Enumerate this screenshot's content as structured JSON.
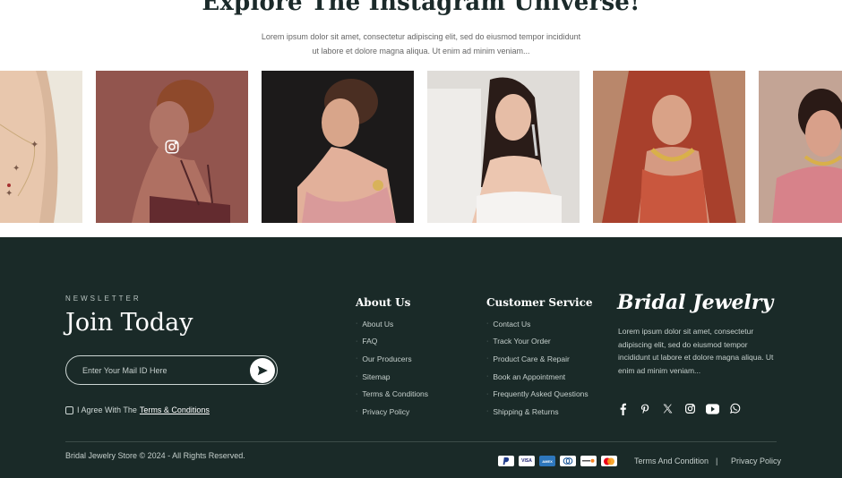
{
  "instagram": {
    "title": "Explore The Instagram Universe!",
    "description": "Lorem ipsum dolor sit amet, consectetur adipiscing elit, sed do eiusmod tempor incididunt ut labore et dolore magna aliqua. Ut enim ad minim veniam..."
  },
  "footer": {
    "newsletter": {
      "kicker": "NEWSLETTER",
      "title": "Join Today",
      "placeholder": "Enter Your Mail ID Here",
      "agree_text": "I Agree With The",
      "agree_link": "Terms & Conditions"
    },
    "about": {
      "title": "About Us",
      "items": [
        "About Us",
        "FAQ",
        "Our Producers",
        "Sitemap",
        "Terms & Conditions",
        "Privacy Policy"
      ]
    },
    "service": {
      "title": "Customer Service",
      "items": [
        "Contact Us",
        "Track Your Order",
        "Product Care & Repair",
        "Book an Appointment",
        "Frequently Asked Questions",
        "Shipping & Returns"
      ]
    },
    "brand": {
      "name": "Bridal Jewelry",
      "description": "Lorem ipsum dolor sit amet, consectetur adipiscing elit, sed do eiusmod tempor incididunt ut labore et dolore magna aliqua. Ut enim ad minim veniam..."
    },
    "social_icons": [
      "facebook-icon",
      "pinterest-icon",
      "x-icon",
      "instagram-icon",
      "youtube-icon",
      "whatsapp-icon"
    ],
    "copyright": "Bridal Jewelry Store © 2024 - All Rights Reserved.",
    "payments": {
      "visa": "VISA",
      "amex": "AMEX"
    },
    "legal": {
      "terms": "Terms And Condition",
      "separator": "|",
      "privacy": "Privacy Policy"
    }
  },
  "colors": {
    "footer_bg": "#1a2a28",
    "title": "#1b2a2a",
    "hover_overlay": "#6e2828"
  }
}
